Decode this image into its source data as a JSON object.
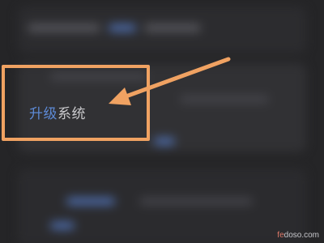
{
  "upgrade_item": {
    "label_accent": "升级",
    "label_rest": "系统"
  },
  "watermark": {
    "brand": "fe",
    "rest": "doso.com"
  },
  "colors": {
    "background": "#252527",
    "highlight_box": "#f0a262",
    "arrow": "#f0a262",
    "accent_text": "#5d8ad6"
  },
  "icons": {
    "pointer": "arrow-icon"
  }
}
